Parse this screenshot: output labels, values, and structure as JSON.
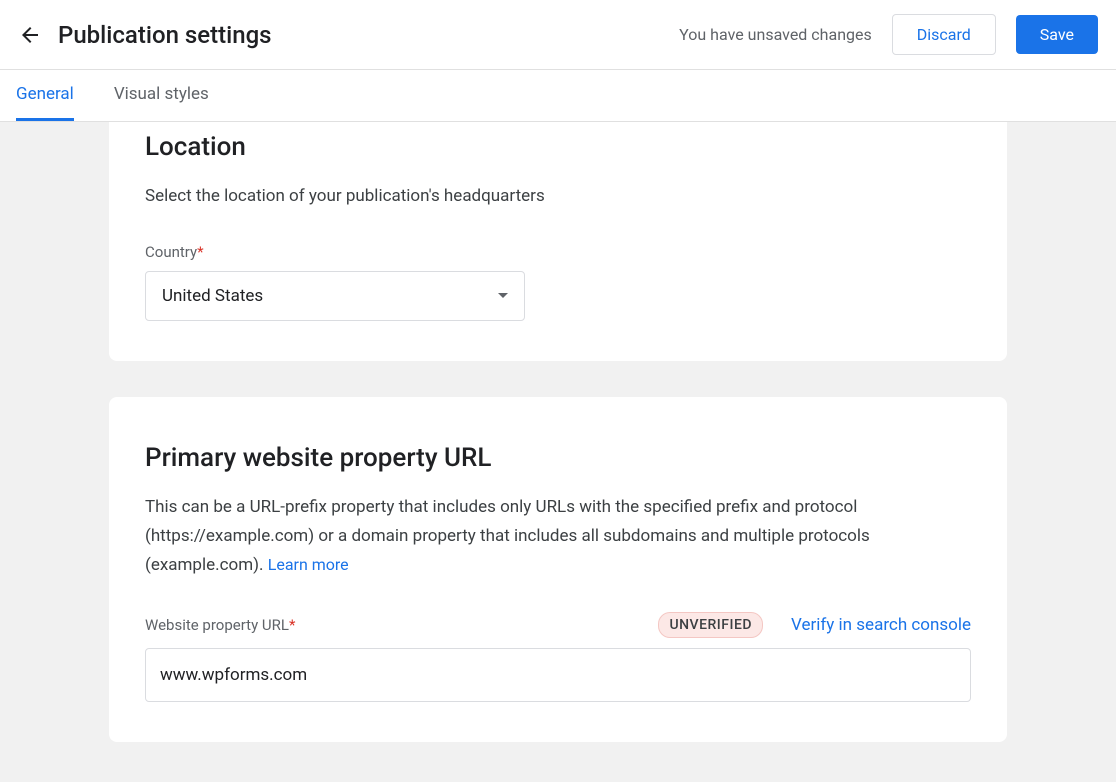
{
  "header": {
    "title": "Publication settings",
    "unsaved_message": "You have unsaved changes",
    "discard_label": "Discard",
    "save_label": "Save"
  },
  "tabs": {
    "general": "General",
    "visual_styles": "Visual styles"
  },
  "location": {
    "title": "Location",
    "description": "Select the location of your publication's headquarters",
    "country_label": "Country",
    "country_value": "United States"
  },
  "website": {
    "title": "Primary website property URL",
    "description": "This can be a URL-prefix property that includes only URLs with the specified prefix and protocol (https://example.com) or a domain property that includes all subdomains and multiple protocols (example.com). ",
    "learn_more": "Learn more",
    "url_label": "Website property URL",
    "badge": "UNVERIFIED",
    "verify_link": "Verify in search console",
    "url_value": "www.wpforms.com"
  }
}
